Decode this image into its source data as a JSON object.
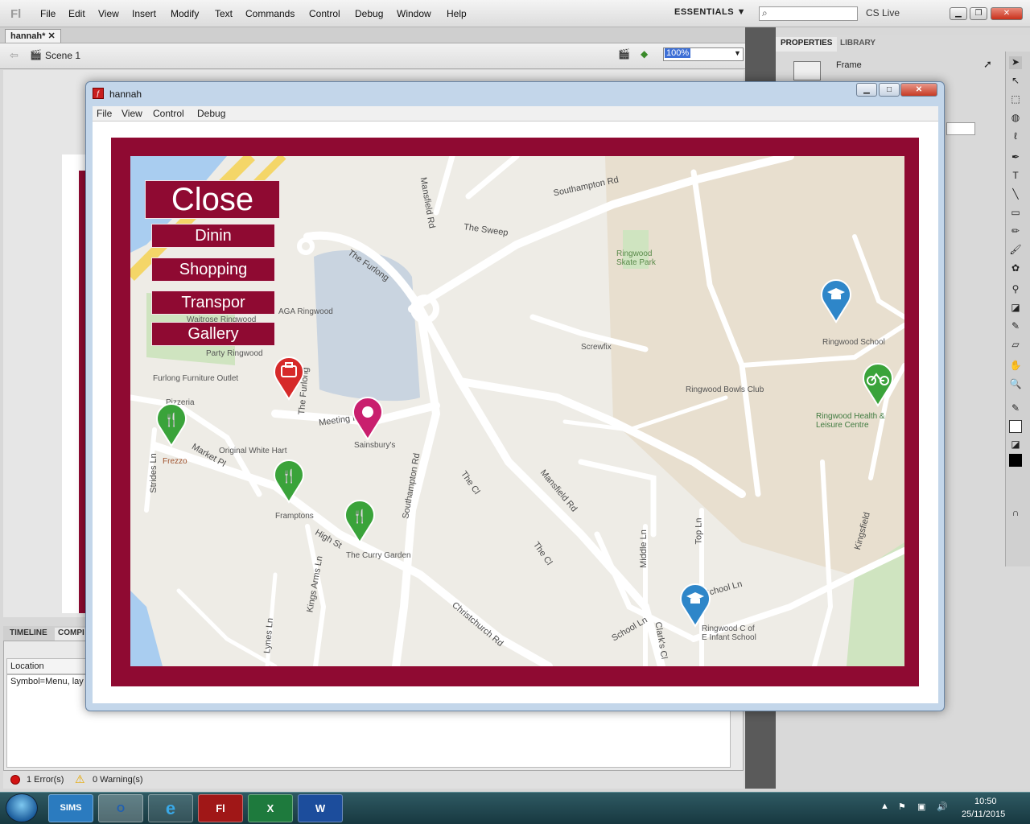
{
  "ide": {
    "logo": "Fl",
    "menus": [
      "File",
      "Edit",
      "View",
      "Insert",
      "Modify",
      "Text",
      "Commands",
      "Control",
      "Debug",
      "Window",
      "Help"
    ],
    "workspace": "ESSENTIALS ▼",
    "search_placeholder": "",
    "cs_live": "CS Live",
    "document_tab": "hannah*",
    "scene": "Scene 1",
    "zoom": "100%",
    "timeline_tab": "TIMELINE",
    "compiler_tab": "COMPI",
    "location_header": "Location",
    "location_row": "Symbol=Menu, lay",
    "errors": "1 Error(s)",
    "warnings": "0 Warning(s)",
    "properties_tab": "PROPERTIES",
    "library_tab": "LIBRARY",
    "frame_label": "Frame"
  },
  "player": {
    "title": "hannah",
    "menus": [
      "File",
      "View",
      "Control",
      "Debug"
    ]
  },
  "app_menu": {
    "close": "Close",
    "buttons": [
      "Dinin",
      "Shopping",
      "Transpor",
      "Gallery"
    ]
  },
  "map": {
    "road_labels": [
      {
        "text": "Southampton Rd",
        "rot": -12
      },
      {
        "text": "The Sweep",
        "rot": 8
      },
      {
        "text": "The Furlong",
        "rot": 35
      },
      {
        "text": "Mansfield Rd",
        "rot": 80
      },
      {
        "text": "Meeting Ho",
        "rot": -8
      },
      {
        "text": "The Furlong",
        "rot": -85
      },
      {
        "text": "Market Pl",
        "rot": 30
      },
      {
        "text": "Strides Ln",
        "rot": -90
      },
      {
        "text": "High St",
        "rot": 30
      },
      {
        "text": "Southampton Rd",
        "rot": -80
      },
      {
        "text": "Mansfield Rd",
        "rot": 50
      },
      {
        "text": "The Cl",
        "rot": 55
      },
      {
        "text": "The Cl",
        "rot": 55
      },
      {
        "text": "Middle Ln",
        "rot": -90
      },
      {
        "text": "Top Ln",
        "rot": -90
      },
      {
        "text": "School Ln",
        "rot": -15
      },
      {
        "text": "Kingsfield",
        "rot": -75
      },
      {
        "text": "Christchurch Rd",
        "rot": 40
      },
      {
        "text": "Kings Arms Ln",
        "rot": -80
      },
      {
        "text": "Lynes Ln",
        "rot": -85
      },
      {
        "text": "School Ln",
        "rot": -30
      },
      {
        "text": "Clark's Cl",
        "rot": 80
      }
    ],
    "place_labels": [
      "AGA Ringwood",
      "Waitrose Ringwood",
      "Party Ringwood",
      "Furlong Furniture Outlet",
      "Pizzeria",
      "Frezzo",
      "Original White Hart",
      "Sainsbury's",
      "Framptons",
      "The Curry Garden",
      "Screwfix",
      "Ringwood Skate Park",
      "Ringwood School",
      "Ringwood Bowls Club",
      "Ringwood Health & Leisure Centre",
      "Ringwood C of E Infant School"
    ],
    "marker_colors": {
      "dining": "#3aa33a",
      "shopping": "#c91f6e",
      "business": "#d62a2a",
      "school": "#2e86c9",
      "leisure": "#3aa33a"
    }
  },
  "taskbar": {
    "apps": [
      "SIMS",
      "O",
      "e",
      "Fl",
      "X",
      "W"
    ],
    "time": "10:50",
    "date": "25/11/2015"
  }
}
